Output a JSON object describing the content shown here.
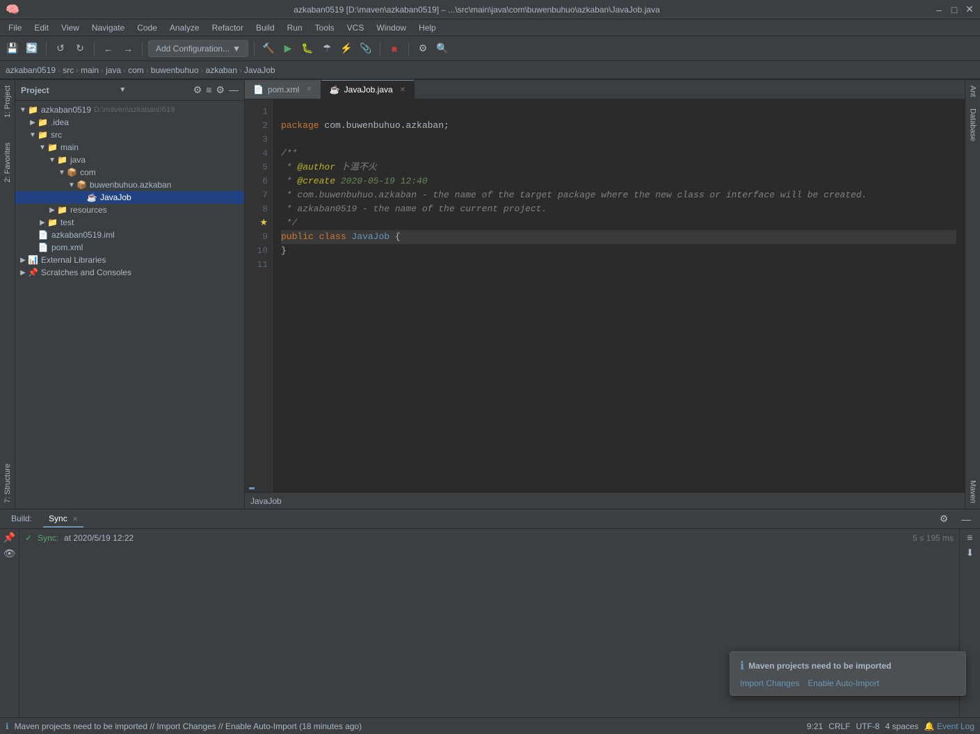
{
  "titlebar": {
    "title": "azkaban0519 [D:\\maven\\azkaban0519] – ...\\src\\main\\java\\com\\buwenbuhuo\\azkaban\\JavaJob.java",
    "app_icon": "intellij-icon"
  },
  "menu": {
    "items": [
      "File",
      "Edit",
      "View",
      "Navigate",
      "Code",
      "Analyze",
      "Refactor",
      "Build",
      "Run",
      "Tools",
      "VCS",
      "Window",
      "Help"
    ]
  },
  "toolbar": {
    "run_config_label": "Add Configuration...",
    "buttons": [
      "save-all",
      "synchronize",
      "undo",
      "redo",
      "find",
      "replace",
      "build-project",
      "run",
      "debug",
      "coverage",
      "profile",
      "attach-debugger",
      "run-config",
      "settings",
      "search-everywhere"
    ]
  },
  "breadcrumb": {
    "items": [
      "azkaban0519",
      "src",
      "main",
      "java",
      "com",
      "buwenbuhuo",
      "azkaban",
      "JavaJob"
    ]
  },
  "sidebar": {
    "title": "Project",
    "tree": [
      {
        "id": "root",
        "label": "azkaban0519",
        "path": "D:\\maven\\azkaban0519",
        "level": 0,
        "expanded": true,
        "type": "module"
      },
      {
        "id": "idea",
        "label": ".idea",
        "level": 1,
        "expanded": false,
        "type": "folder"
      },
      {
        "id": "src",
        "label": "src",
        "level": 1,
        "expanded": true,
        "type": "source-root"
      },
      {
        "id": "main",
        "label": "main",
        "level": 2,
        "expanded": true,
        "type": "folder"
      },
      {
        "id": "java",
        "label": "java",
        "level": 3,
        "expanded": true,
        "type": "source-root"
      },
      {
        "id": "com",
        "label": "com",
        "level": 4,
        "expanded": true,
        "type": "package"
      },
      {
        "id": "buwenbuhuo",
        "label": "buwenbuhuo.azkaban",
        "level": 5,
        "expanded": true,
        "type": "package"
      },
      {
        "id": "javajob",
        "label": "JavaJob",
        "level": 6,
        "expanded": false,
        "type": "java",
        "selected": true
      },
      {
        "id": "resources",
        "label": "resources",
        "level": 3,
        "expanded": false,
        "type": "folder"
      },
      {
        "id": "test",
        "label": "test",
        "level": 2,
        "expanded": false,
        "type": "folder"
      },
      {
        "id": "iml",
        "label": "azkaban0519.iml",
        "level": 1,
        "expanded": false,
        "type": "iml"
      },
      {
        "id": "pom",
        "label": "pom.xml",
        "level": 1,
        "expanded": false,
        "type": "xml"
      },
      {
        "id": "extlibs",
        "label": "External Libraries",
        "level": 0,
        "expanded": false,
        "type": "folder"
      },
      {
        "id": "scratches",
        "label": "Scratches and Consoles",
        "level": 0,
        "expanded": false,
        "type": "folder"
      }
    ]
  },
  "editor": {
    "tabs": [
      {
        "id": "pom",
        "label": "pom.xml",
        "type": "xml",
        "active": false,
        "modified": false
      },
      {
        "id": "javajob",
        "label": "JavaJob.java",
        "type": "java",
        "active": true,
        "modified": false
      }
    ],
    "footer_label": "JavaJob",
    "code": {
      "lines": [
        {
          "num": 1,
          "text": "package com.buwenbuhuo.azkaban;"
        },
        {
          "num": 2,
          "text": ""
        },
        {
          "num": 3,
          "text": "/**"
        },
        {
          "num": 4,
          "text": " * @author 卜温不火"
        },
        {
          "num": 5,
          "text": " * @create 2020-05-19 12:40"
        },
        {
          "num": 6,
          "text": " * com.buwenbuhuo.azkaban - the name of the target package where the new class or interface will be created."
        },
        {
          "num": 7,
          "text": " * azkaban0519 - the name of the current project."
        },
        {
          "num": 8,
          "text": " */"
        },
        {
          "num": 9,
          "text": "public class JavaJob {"
        },
        {
          "num": 10,
          "text": "}"
        },
        {
          "num": 11,
          "text": ""
        }
      ]
    }
  },
  "bottom_panel": {
    "tabs": [
      {
        "id": "build",
        "label": "Build",
        "active": false
      },
      {
        "id": "sync",
        "label": "Sync",
        "active": true,
        "closeable": true
      }
    ],
    "sync_entry": {
      "icon": "check",
      "label": "Sync:",
      "time": "at 2020/5/19 12:22",
      "duration": "5 s 195 ms"
    }
  },
  "status_bar": {
    "message": "Maven projects need to be imported // Import Changes // Enable Auto-Import (18 minutes ago)",
    "position": "9:21",
    "encoding": "CRLF",
    "charset": "UTF-8",
    "indent": "4 spaces",
    "event_log": "Event Log",
    "info_icon": "info-icon"
  },
  "notification": {
    "icon": "ℹ",
    "title": "Maven projects need to be imported",
    "links": [
      {
        "label": "Import Changes",
        "id": "import-changes-link"
      },
      {
        "label": "Enable Auto-Import",
        "id": "enable-auto-import-link"
      }
    ]
  },
  "side_tabs": {
    "left": [
      {
        "id": "project",
        "label": "1: Project"
      },
      {
        "id": "favorites",
        "label": "2: Favorites"
      },
      {
        "id": "structure",
        "label": "7: Structure"
      }
    ],
    "right": [
      {
        "id": "ant",
        "label": "Ant"
      },
      {
        "id": "database",
        "label": "Database"
      },
      {
        "id": "maven",
        "label": "Maven"
      }
    ]
  }
}
